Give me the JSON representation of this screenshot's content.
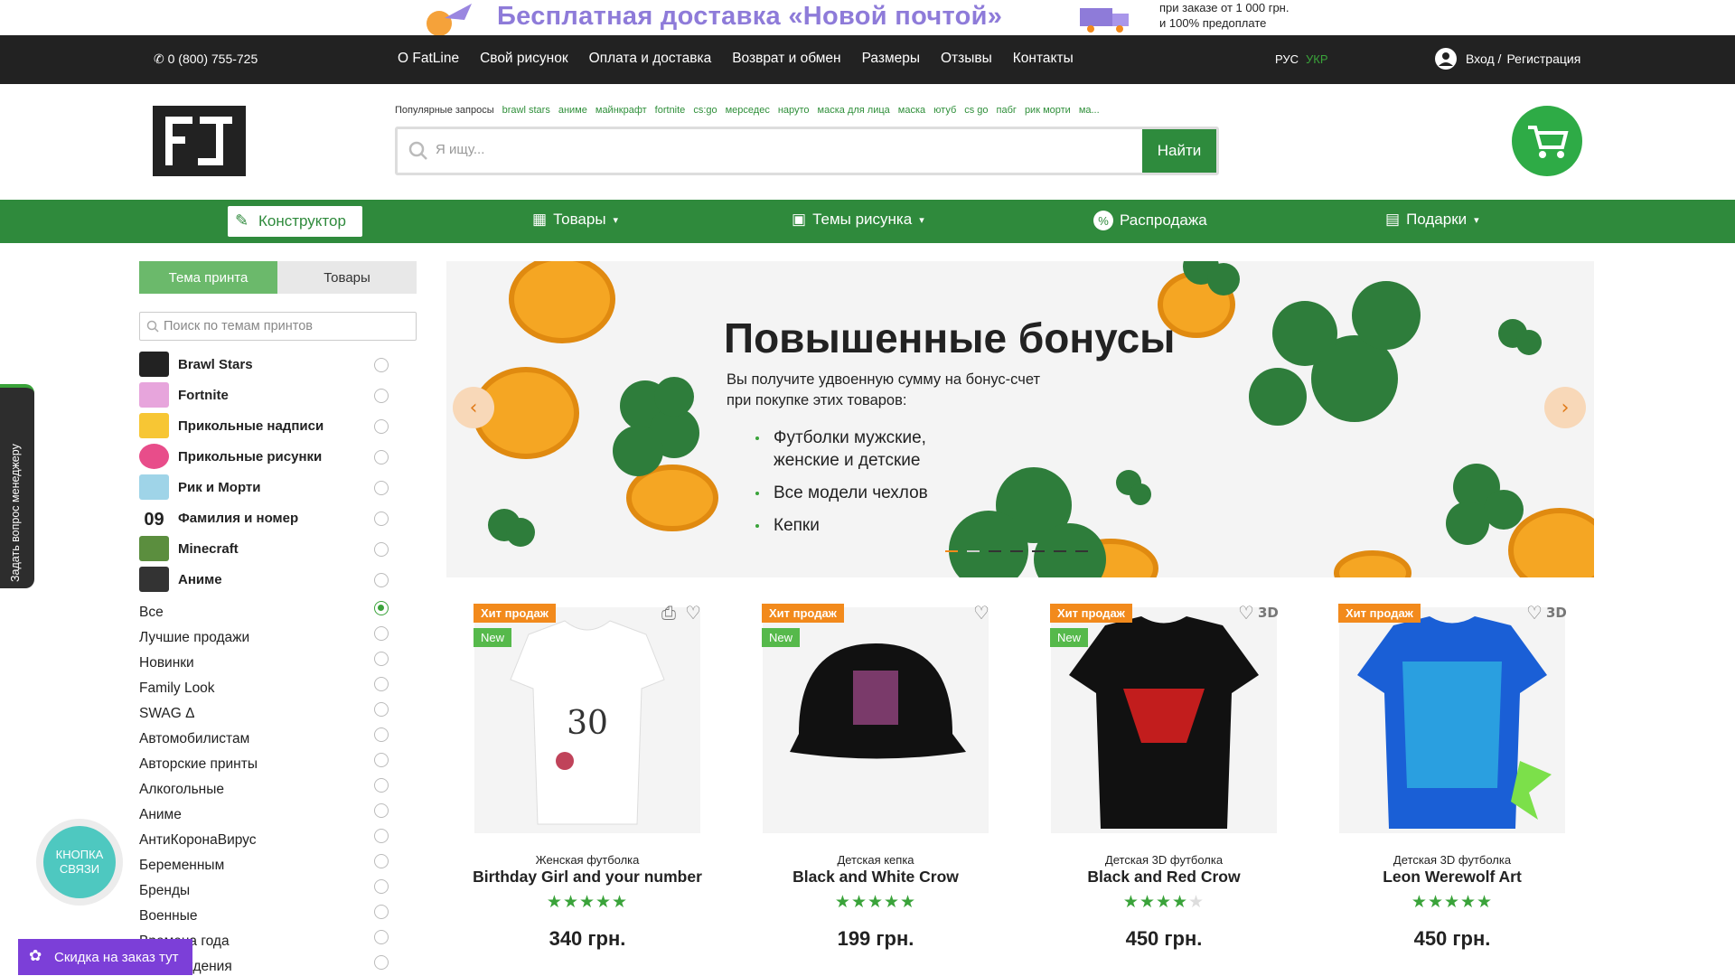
{
  "promo": {
    "title": "Бесплатная доставка «Новой почтой»",
    "note_line1": "при заказе от 1 000 грн.",
    "note_line2": "и 100% предоплате"
  },
  "topbar": {
    "phone": "0 (800) 755-725",
    "nav": [
      "О FatLine",
      "Свой рисунок",
      "Оплата и доставка",
      "Возврат и обмен",
      "Размеры",
      "Отзывы",
      "Контакты"
    ],
    "lang_ru": "РУС",
    "lang_ua": "УКР",
    "login": "Вход /",
    "register": "Регистрация"
  },
  "header": {
    "popular_label": "Популярные запросы",
    "popular": [
      "brawl stars",
      "аниме",
      "майнкрафт",
      "fortnite",
      "cs:go",
      "мерседес",
      "наруто",
      "маска для лица",
      "маска",
      "ютуб",
      "cs go",
      "пабг",
      "рик морти",
      "ма..."
    ],
    "search_placeholder": "Я ищу...",
    "search_button": "Найти"
  },
  "greennav": {
    "constructor": "Конструктор",
    "goods": "Товары",
    "themes": "Темы рисунка",
    "sale": "Распродажа",
    "gifts": "Подарки"
  },
  "sidebar": {
    "tab_theme": "Тема принта",
    "tab_goods": "Товары",
    "search_placeholder": "Поиск по темам принтов",
    "themes": [
      "Brawl Stars",
      "Fortnite",
      "Прикольные надписи",
      "Прикольные рисунки",
      "Рик и Морти",
      "Фамилия и номер",
      "Minecraft",
      "Аниме"
    ],
    "categories": [
      "Все",
      "Лучшие продажи",
      "Новинки",
      "Family Look",
      "SWAG Δ",
      "Автомобилистам",
      "Авторские принты",
      "Алкогольные",
      "Аниме",
      "АнтиКоронаВирус",
      "Беременным",
      "Бренды",
      "Военные",
      "Времена года",
      "Дни рождения"
    ]
  },
  "banner": {
    "heading": "Повышенные бонусы",
    "sub1": "Вы получите удвоенную сумму на бонус-счет",
    "sub2": "при покупке этих товаров:",
    "items": [
      "Футболки мужские, женские и детские",
      "Все модели чехлов",
      "Кепки"
    ]
  },
  "products": [
    {
      "type": "Женская футболка",
      "name": "Birthday Girl and your number",
      "price": "340 грн.",
      "rating": 5,
      "hit": "Хит продаж",
      "new": "New"
    },
    {
      "type": "Детская кепка",
      "name": "Black and White Crow",
      "price": "199 грн.",
      "rating": 5,
      "hit": "Хит продаж",
      "new": "New"
    },
    {
      "type": "Детская 3D футболка",
      "name": "Black and Red Crow",
      "price": "450 грн.",
      "rating": 4,
      "hit": "Хит продаж",
      "new": "New"
    },
    {
      "type": "Детская 3D футболка",
      "name": "Leon Werewolf Art",
      "price": "450 грн.",
      "rating": 5,
      "hit": "Хит продаж"
    }
  ],
  "floating": {
    "ask_manager": "Задать вопрос менеджеру",
    "contact_button": "КНОПКА СВЯЗИ",
    "discount": "Скидка на заказ тут"
  },
  "colors": {
    "brand_green": "#2f8a3c",
    "accent_orange": "#f28a1c",
    "purple": "#7c3fd8"
  }
}
